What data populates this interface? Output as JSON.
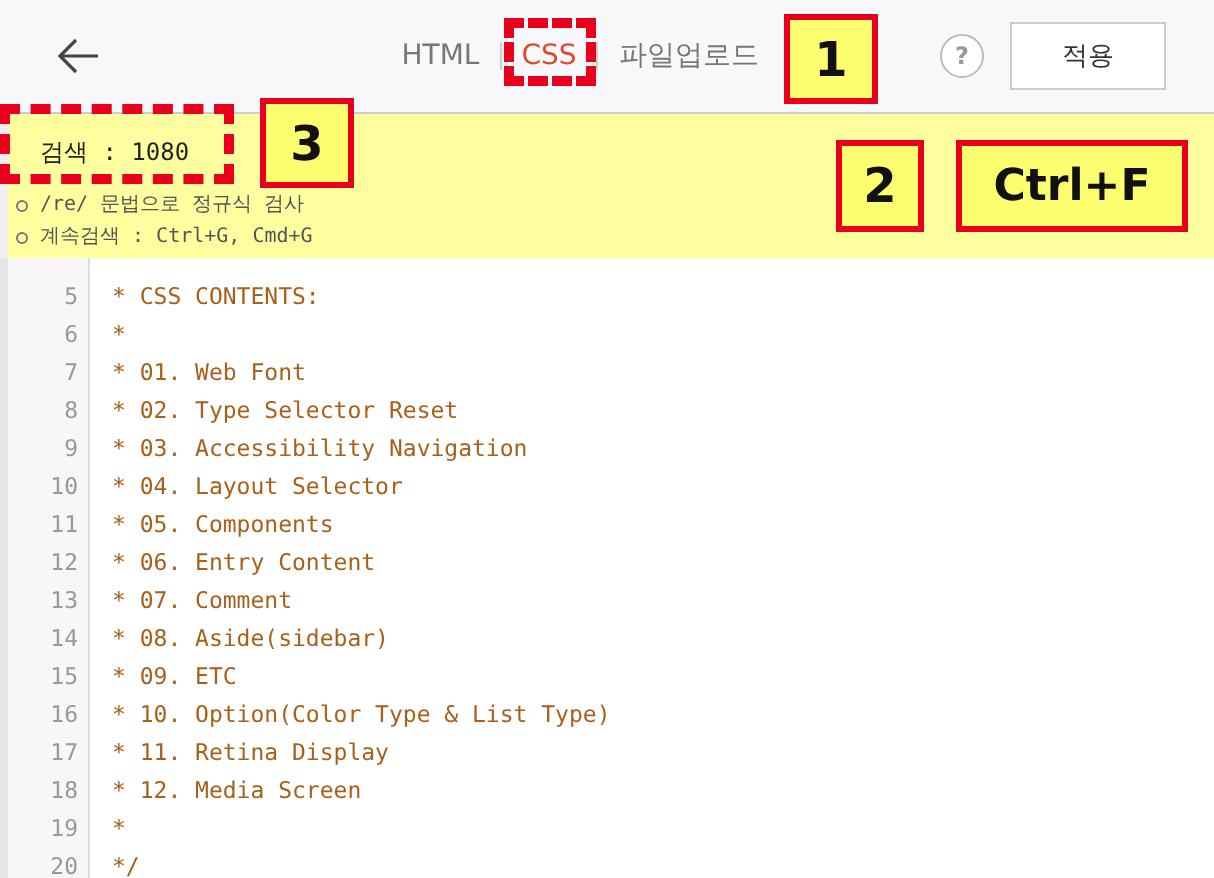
{
  "header": {
    "tabs": [
      {
        "label": "HTML",
        "selected": false
      },
      {
        "label": "CSS",
        "selected": true
      },
      {
        "label": "파일업로드",
        "selected": false
      }
    ],
    "help": "?",
    "apply_button": "적용"
  },
  "search_panel": {
    "query": "검색 : 1080",
    "hints": [
      "/re/ 문법으로 정규식 검사",
      "계속검색 : Ctrl+G, Cmd+G"
    ]
  },
  "code": {
    "lines": [
      {
        "number": "5",
        "text": "* CSS CONTENTS:"
      },
      {
        "number": "6",
        "text": "*"
      },
      {
        "number": "7",
        "text": "* 01. Web Font"
      },
      {
        "number": "8",
        "text": "* 02. Type Selector Reset"
      },
      {
        "number": "9",
        "text": "* 03. Accessibility Navigation"
      },
      {
        "number": "10",
        "text": "* 04. Layout Selector"
      },
      {
        "number": "11",
        "text": "* 05. Components"
      },
      {
        "number": "12",
        "text": "* 06. Entry Content"
      },
      {
        "number": "13",
        "text": "* 07. Comment"
      },
      {
        "number": "14",
        "text": "* 08. Aside(sidebar)"
      },
      {
        "number": "15",
        "text": "* 09. ETC"
      },
      {
        "number": "16",
        "text": "* 10. Option(Color Type & List Type)"
      },
      {
        "number": "17",
        "text": "* 11. Retina Display"
      },
      {
        "number": "18",
        "text": "* 12. Media Screen"
      },
      {
        "number": "19",
        "text": "*"
      },
      {
        "number": "20",
        "text": "*/"
      }
    ]
  },
  "annotations": [
    {
      "kind": "frame"
    },
    {
      "kind": "label",
      "text": "1"
    },
    {
      "kind": "frame"
    },
    {
      "kind": "label",
      "text": "3"
    },
    {
      "kind": "label",
      "text": "2"
    },
    {
      "kind": "label",
      "text": "Ctrl+F"
    }
  ]
}
